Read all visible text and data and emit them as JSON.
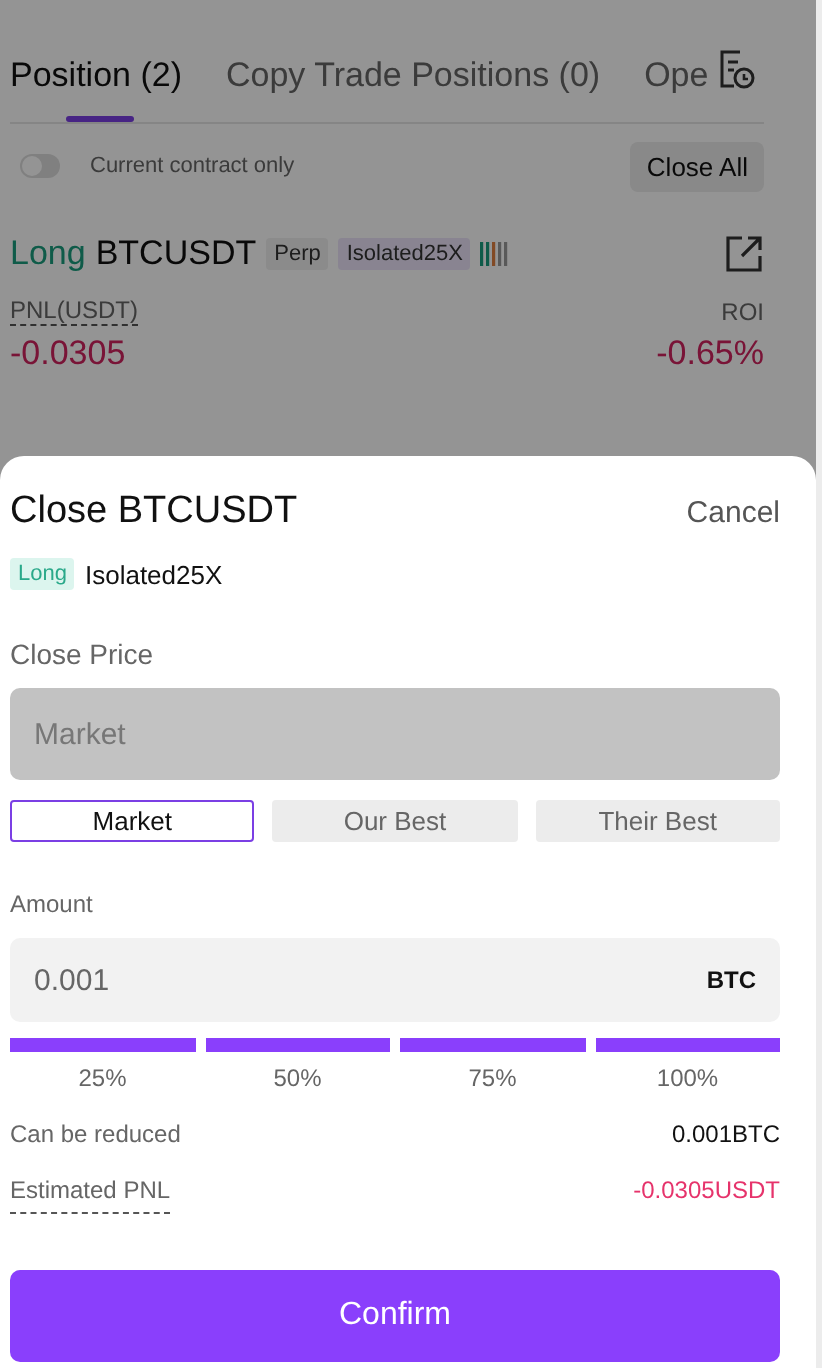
{
  "tabs": [
    {
      "label": "Position (2)",
      "selected": true
    },
    {
      "label": "Copy Trade Positions (0)",
      "selected": false
    },
    {
      "label": "Ope",
      "selected": false
    }
  ],
  "filter": {
    "label": "Current contract only",
    "on": false
  },
  "close_all_button": "Close All",
  "position": {
    "side": "Long",
    "symbol": "BTCUSDT",
    "tags": [
      "Perp",
      "Isolated25X"
    ],
    "pnl_label": "PNL(USDT)",
    "pnl": "-0.0305",
    "roi_label": "ROI",
    "roi": "-0.65%"
  },
  "sheet": {
    "title": "Close BTCUSDT",
    "cancel": "Cancel",
    "side_tag": "Long",
    "mode": "Isolated25X",
    "close_price_label": "Close Price",
    "close_price_placeholder": "Market",
    "price_options": [
      {
        "label": "Market",
        "selected": true
      },
      {
        "label": "Our Best",
        "selected": false
      },
      {
        "label": "Their Best",
        "selected": false
      }
    ],
    "amount_label": "Amount",
    "amount": "0.001",
    "amount_unit": "BTC",
    "percents": [
      {
        "label": "25%",
        "filled": true
      },
      {
        "label": "50%",
        "filled": true
      },
      {
        "label": "75%",
        "filled": true
      },
      {
        "label": "100%",
        "filled": true
      }
    ],
    "reducible_label": "Can be reduced",
    "reducible": "0.001BTC",
    "est_pnl_label": "Estimated PNL",
    "est_pnl": "-0.0305USDT",
    "confirm": "Confirm"
  }
}
